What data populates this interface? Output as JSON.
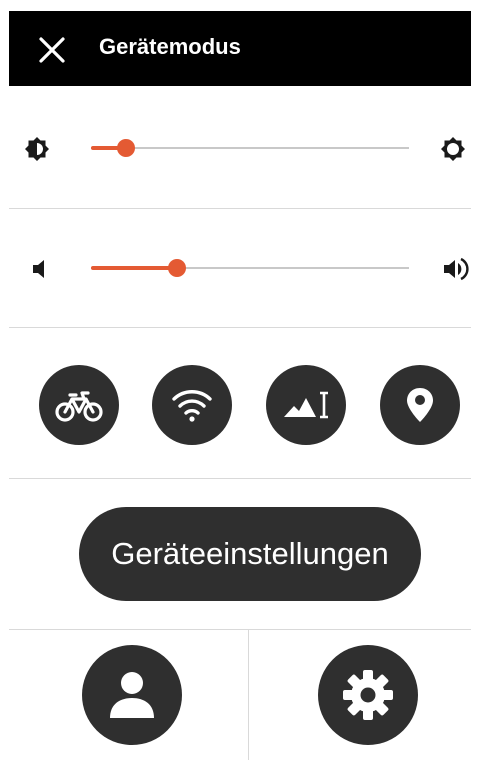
{
  "header": {
    "title": "Gerätemodus",
    "close_icon": "close-icon"
  },
  "brightness": {
    "level": 0.11,
    "min_icon": "brightness-low-icon",
    "max_icon": "brightness-high-icon"
  },
  "volume": {
    "level": 0.27,
    "min_icon": "volume-low-icon",
    "max_icon": "volume-high-icon"
  },
  "quick_actions": [
    {
      "icon": "bike-icon"
    },
    {
      "icon": "wifi-icon"
    },
    {
      "icon": "elevation-icon"
    },
    {
      "icon": "location-pin-icon"
    }
  ],
  "device_settings": {
    "label": "Geräteeinstellungen"
  },
  "bottom_actions": [
    {
      "icon": "user-icon"
    },
    {
      "icon": "gear-icon"
    }
  ],
  "colors": {
    "accent": "#e45a33",
    "header_bg": "#000000",
    "button_bg": "#2f2f2f",
    "divider": "#d9d9d9"
  }
}
